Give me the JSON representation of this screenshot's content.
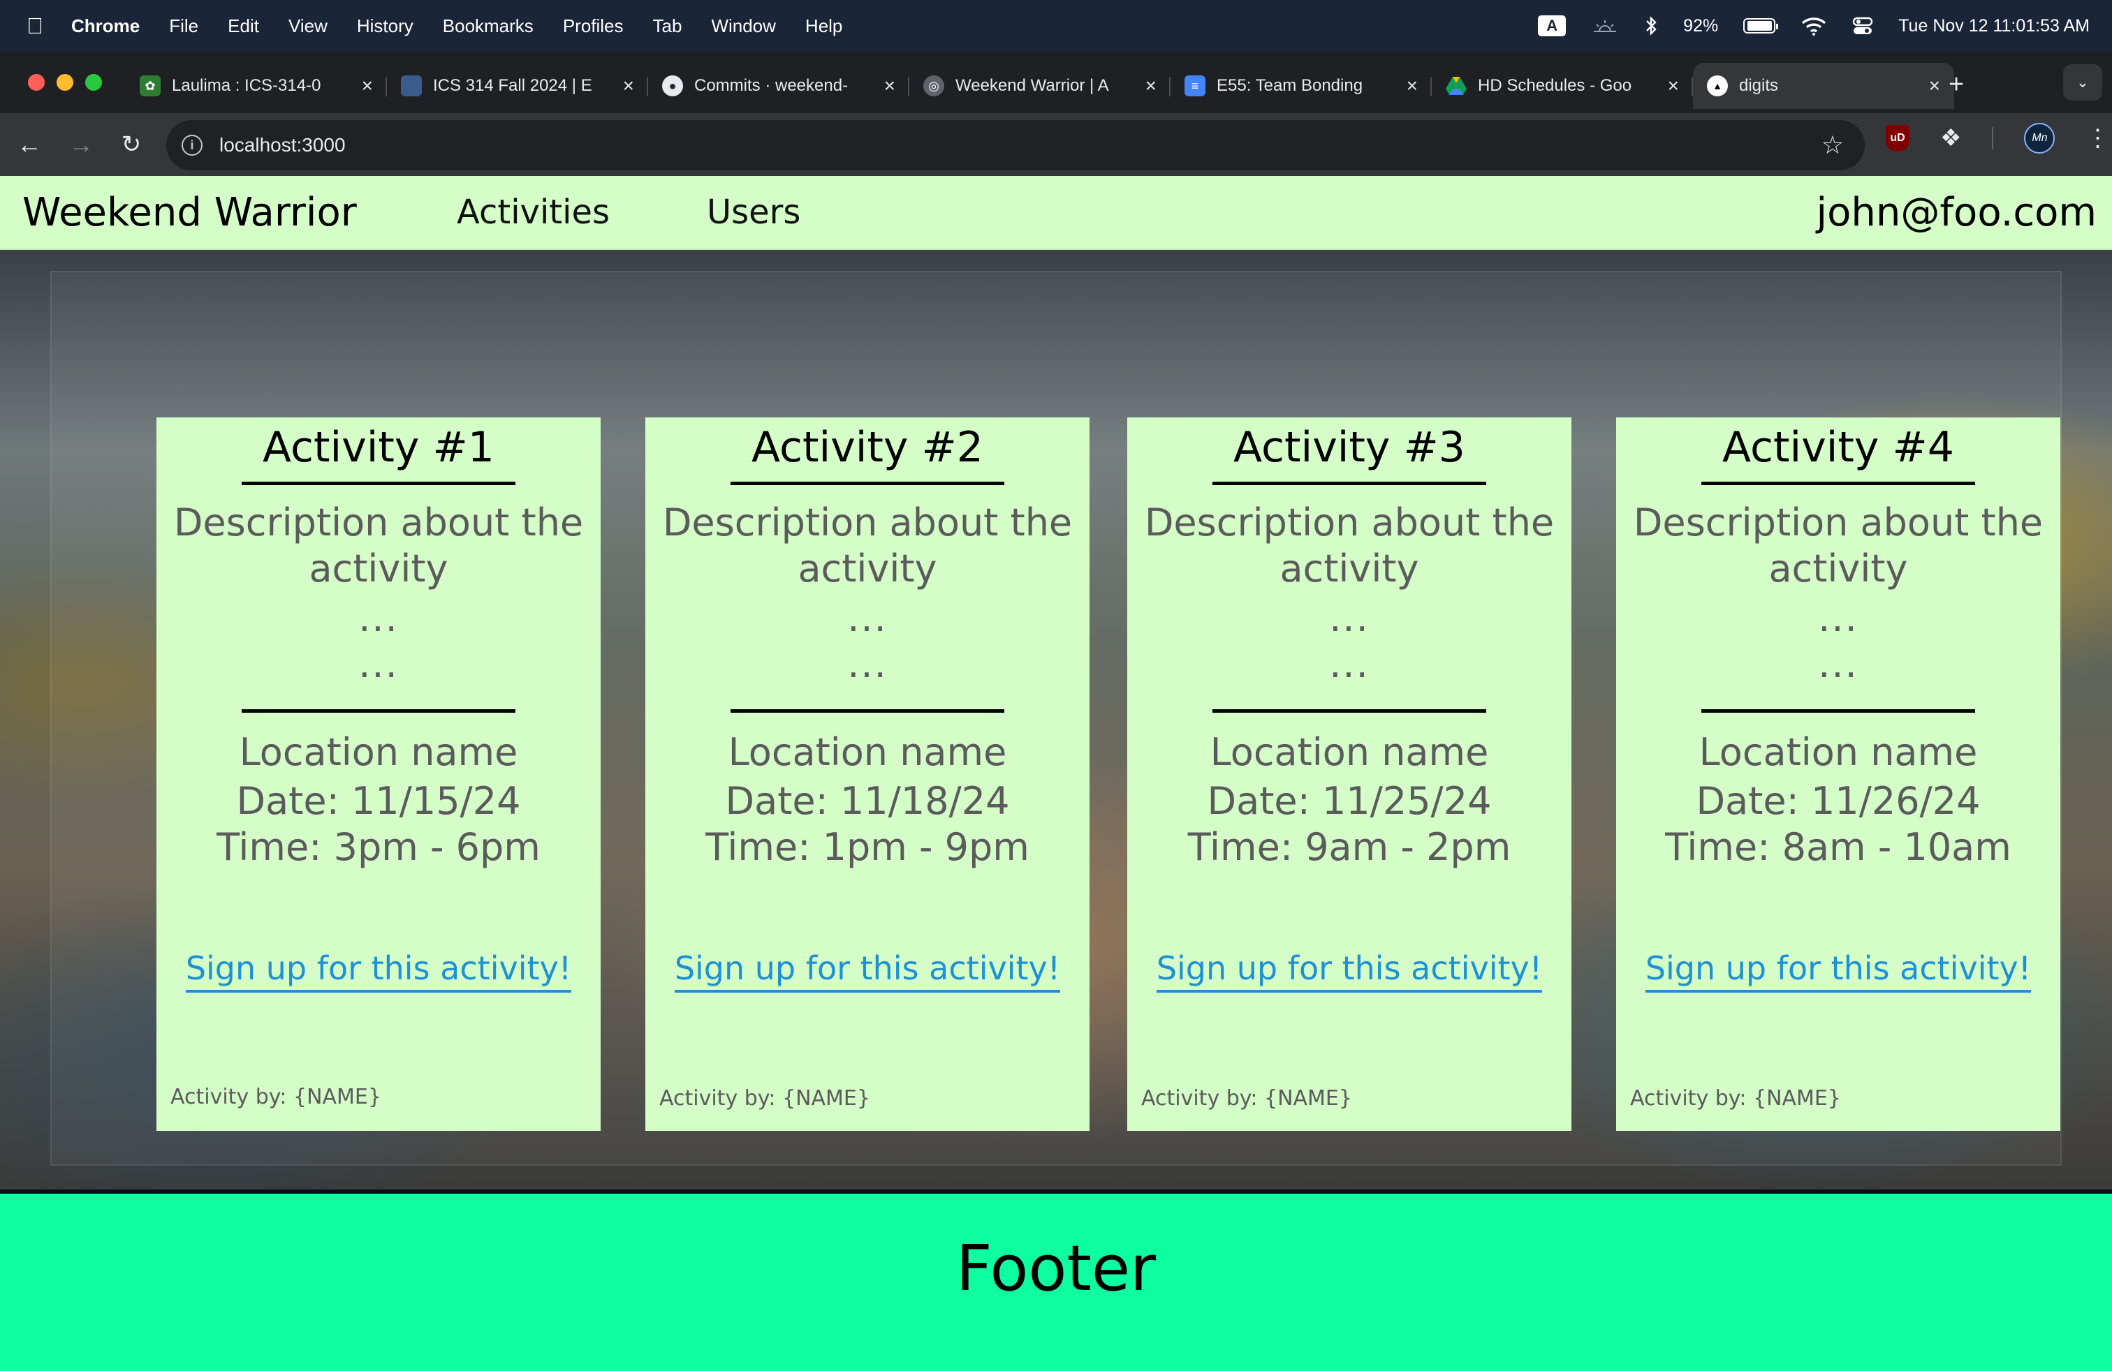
{
  "menubar": {
    "app_name": "Chrome",
    "items": [
      "File",
      "Edit",
      "View",
      "History",
      "Bookmarks",
      "Profiles",
      "Tab",
      "Window",
      "Help"
    ],
    "input_indicator": "A",
    "battery": "92%",
    "battery_level": 0.92,
    "datetime": "Tue Nov 12  11:01:53 AM"
  },
  "tabs": [
    {
      "title": "Laulima : ICS-314-0",
      "icon": "laulima-icon",
      "color": "#2e7d32"
    },
    {
      "title": "ICS 314 Fall 2024 | E",
      "icon": "course-site-icon",
      "color": "#3b5b8c"
    },
    {
      "title": "Commits · weekend-",
      "icon": "github-icon",
      "color": "#24292f"
    },
    {
      "title": "Weekend Warrior | A",
      "icon": "globe-icon",
      "color": "#5f6368"
    },
    {
      "title": "E55: Team Bonding",
      "icon": "google-docs-icon",
      "color": "#4285f4"
    },
    {
      "title": "HD Schedules - Goo",
      "icon": "google-drive-icon",
      "color": "#0f9d58"
    },
    {
      "title": "digits",
      "icon": "app-triangle-icon",
      "color": "#000000",
      "active": true
    }
  ],
  "toolbar": {
    "url": "localhost:3000",
    "extension_label": "uD",
    "profile_label": "Mn"
  },
  "navbar": {
    "brand": "Weekend Warrior",
    "links": [
      "Activities",
      "Users"
    ],
    "user": "john@foo.com"
  },
  "activities": [
    {
      "title": "Activity #1",
      "description": "Description about the activity",
      "ellipsis": [
        "...",
        "..."
      ],
      "location": "Location name",
      "date": "Date: 11/15/24",
      "time": "Time: 3pm - 6pm",
      "signup": "Sign up for this activity!",
      "by": "Activity by: {NAME}"
    },
    {
      "title": "Activity #2",
      "description": "Description about the activity",
      "ellipsis": [
        "...",
        "..."
      ],
      "location": "Location name",
      "date": "Date: 11/18/24",
      "time": "Time: 1pm - 9pm",
      "signup": "Sign up for this activity!",
      "by": "Activity by: {NAME}"
    },
    {
      "title": "Activity #3",
      "description": "Description about the activity",
      "ellipsis": [
        "...",
        "..."
      ],
      "location": "Location name",
      "date": "Date: 11/25/24",
      "time": "Time: 9am - 2pm",
      "signup": "Sign up for this activity!",
      "by": "Activity by: {NAME}"
    },
    {
      "title": "Activity #4",
      "description": "Description about the activity",
      "ellipsis": [
        "...",
        "..."
      ],
      "location": "Location name",
      "date": "Date: 11/26/24",
      "time": "Time: 8am - 10am",
      "signup": "Sign up for this activity!",
      "by": "Activity by: {NAME}"
    }
  ],
  "footer": {
    "text": "Footer"
  },
  "colors": {
    "navbar_bg": "#d4fdc8",
    "card_bg": "#d4fdc8",
    "footer_bg": "#0efda0",
    "link": "#1e90d6"
  }
}
